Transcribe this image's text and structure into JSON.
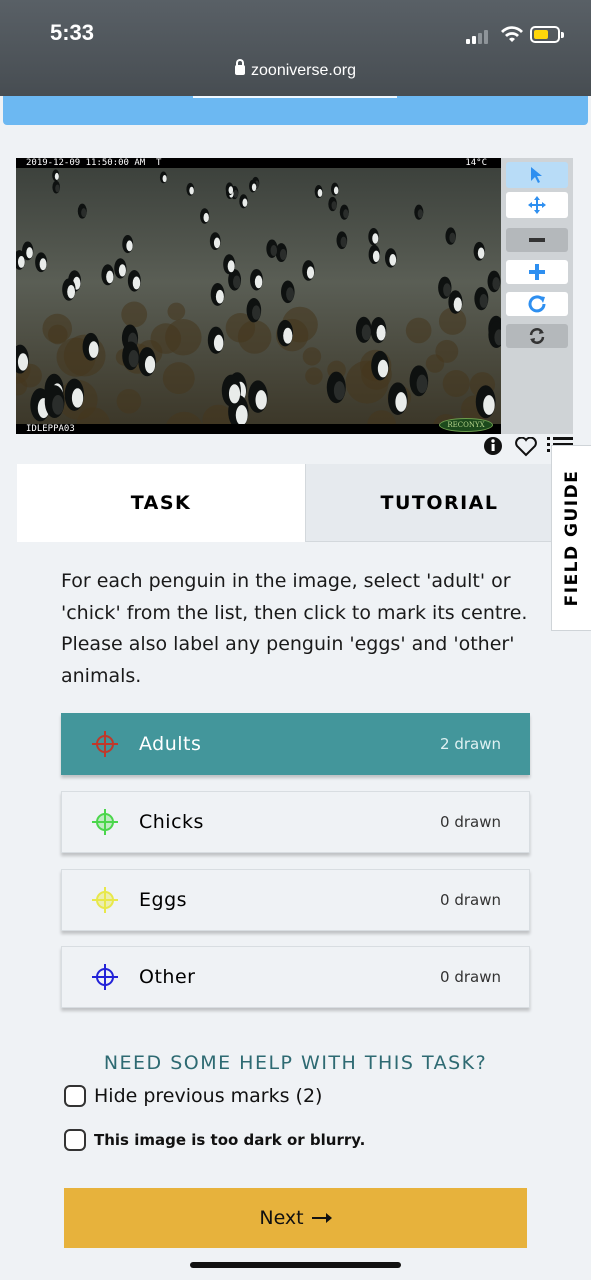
{
  "status_bar": {
    "time": "5:33",
    "url": "zooniverse.org"
  },
  "subject": {
    "timestamp": "2019-12-09 11:50:00 AM  T",
    "temperature": "14°C",
    "camera_id": "IDLEPPA03",
    "brand_logo": "RECONYX"
  },
  "toolbar": {
    "icons": [
      "pointer-icon",
      "move-icon",
      "zoom-out-icon",
      "zoom-in-icon",
      "rotate-icon",
      "reset-icon"
    ],
    "active_color": "#2e8ff0"
  },
  "tabs": {
    "task": "TASK",
    "tutorial": "TUTORIAL"
  },
  "field_guide": "FIELD GUIDE",
  "instructions": "For each penguin in the image, select 'adult' or 'chick' from the list, then click to mark its centre. Please also label any penguin 'eggs' and 'other' animals.",
  "tools": [
    {
      "label": "Adults",
      "count": "2 drawn",
      "color": "#c0392b",
      "active": true
    },
    {
      "label": "Chicks",
      "count": "0 drawn",
      "color": "#4bd64b",
      "active": false
    },
    {
      "label": "Eggs",
      "count": "0 drawn",
      "color": "#e8e84a",
      "active": false
    },
    {
      "label": "Other",
      "count": "0 drawn",
      "color": "#2323d8",
      "active": false
    }
  ],
  "help_text": "NEED SOME HELP WITH THIS TASK?",
  "checkboxes": {
    "hide_marks": "Hide previous marks (2)",
    "too_dark": "This image is too dark or blurry."
  },
  "next_button": "Next",
  "colors": {
    "accent_teal": "#43969b",
    "next_yellow": "#e7b23c",
    "header_blue": "#6cb8f2"
  }
}
